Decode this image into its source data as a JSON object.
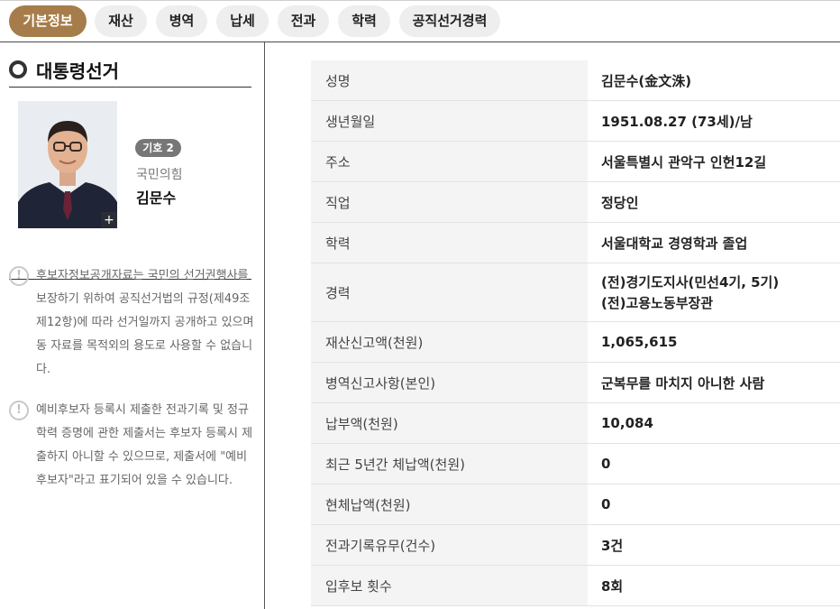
{
  "tabs": [
    {
      "label": "기본정보",
      "active": true
    },
    {
      "label": "재산",
      "active": false
    },
    {
      "label": "병역",
      "active": false
    },
    {
      "label": "납세",
      "active": false
    },
    {
      "label": "전과",
      "active": false
    },
    {
      "label": "학력",
      "active": false
    },
    {
      "label": "공직선거경력",
      "active": false
    }
  ],
  "sidebar": {
    "title": "대통령선거",
    "badge": "기호 2",
    "party": "국민의힘",
    "name": "김문수",
    "photo_plus": "+",
    "notes": [
      {
        "icon": "!",
        "text": "후보자정보공개자료는 국민의 선거권행사를 보장하기 위하여 공직선거법의 규정(제49조 제12항)에 따라 선거일까지 공개하고 있으며 동 자료를 목적외의 용도로 사용할 수 없습니다."
      },
      {
        "icon": "!",
        "text": "예비후보자 등록시 제출한 전과기록 및 정규학력 증명에 관한 제출서는 후보자 등록시 제출하지 아니할 수 있으므로, 제출서에 \"예비후보자\"라고 표기되어 있을 수 있습니다."
      }
    ]
  },
  "info_rows": [
    {
      "label": "성명",
      "value": "김문수(金文洙)"
    },
    {
      "label": "생년월일",
      "value": "1951.08.27 (73세)/남"
    },
    {
      "label": "주소",
      "value": "서울특별시 관악구 인헌12길"
    },
    {
      "label": "직업",
      "value": "정당인"
    },
    {
      "label": "학력",
      "value": "서울대학교 경영학과 졸업"
    },
    {
      "label": "경력",
      "values": [
        "(전)경기도지사(민선4기, 5기)",
        "(전)고용노동부장관"
      ]
    },
    {
      "label": "재산신고액(천원)",
      "value": "1,065,615"
    },
    {
      "label": "병역신고사항(본인)",
      "value": "군복무를 마치지 아니한 사람"
    },
    {
      "label": "납부액(천원)",
      "value": "10,084"
    },
    {
      "label": "최근 5년간 체납액(천원)",
      "value": "0"
    },
    {
      "label": "현체납액(천원)",
      "value": "0"
    },
    {
      "label": "전과기록유무(건수)",
      "value": "3건"
    },
    {
      "label": "입후보 횟수",
      "value": "8회"
    }
  ],
  "colors": {
    "active_tab": "#a67d4a",
    "tab_bg": "#eeeeee",
    "label_bg": "#f4f4f4",
    "badge_bg": "#777777"
  }
}
